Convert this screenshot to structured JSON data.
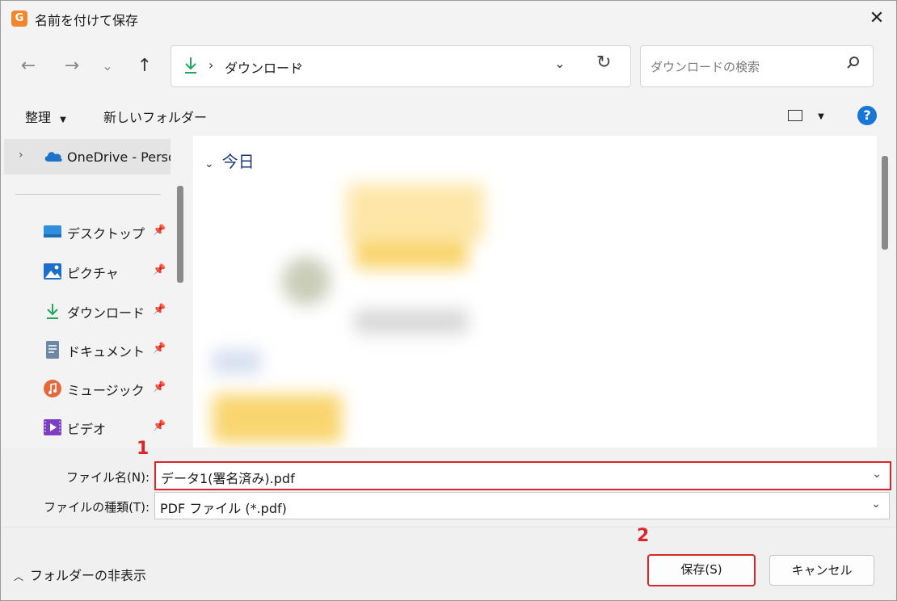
{
  "window": {
    "title": "名前を付けて保存",
    "close_glyph": "✕"
  },
  "address_bar": {
    "breadcrumb": [
      "ダウンロード"
    ],
    "separator": "›",
    "trailing_separator": "›"
  },
  "search": {
    "placeholder": "ダウンロードの検索"
  },
  "toolbar": {
    "organize_label": "整理",
    "new_folder_label": "新しいフォルダー",
    "help_glyph": "?"
  },
  "sidebar": {
    "onedrive_label": "OneDrive - Personal",
    "quick_access": [
      {
        "label": "デスクトップ",
        "icon": "desktop-icon"
      },
      {
        "label": "ピクチャ",
        "icon": "pictures-icon"
      },
      {
        "label": "ダウンロード",
        "icon": "download-icon"
      },
      {
        "label": "ドキュメント",
        "icon": "documents-icon"
      },
      {
        "label": "ミュージック",
        "icon": "music-icon"
      },
      {
        "label": "ビデオ",
        "icon": "video-icon"
      }
    ]
  },
  "main": {
    "group_label": "今日"
  },
  "form": {
    "filename_label": "ファイル名(N):",
    "filename_value": "データ1(署名済み).pdf",
    "filetype_label": "ファイルの種類(T):",
    "filetype_value": "PDF ファイル (*.pdf)"
  },
  "annotations": {
    "step1": "1",
    "step2": "2",
    "highlight_color": "#d9262b"
  },
  "footer": {
    "hide_folders_label": "フォルダーの非表示",
    "save_label": "保存(S)",
    "cancel_label": "キャンセル"
  },
  "colors": {
    "accent": "#1677d6",
    "onedrive": "#1e73c9",
    "download": "#21a45b"
  }
}
